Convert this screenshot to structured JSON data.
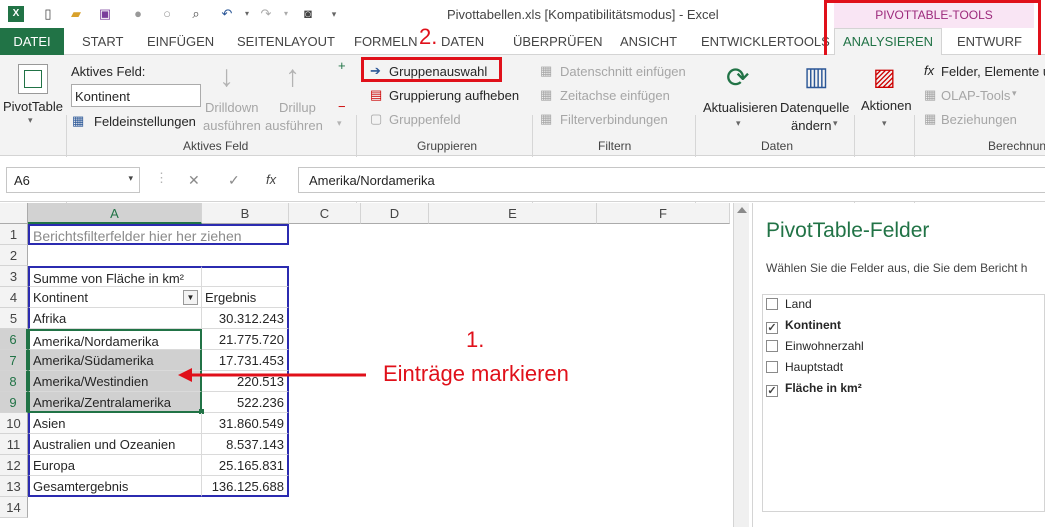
{
  "title": {
    "text": "Pivottabellen.xls  [Kompatibilitätsmodus] - Excel"
  },
  "qat": {
    "icons": [
      "excel-logo-icon",
      "new-file-icon",
      "open-folder-icon",
      "save-icon",
      "circle-icon",
      "print-preview-icon",
      "undo-icon",
      "redo-icon",
      "camera-icon",
      "qat-customize-icon"
    ]
  },
  "context": {
    "label": "PIVOTTABLE-TOOLS"
  },
  "tabs": {
    "file": "DATEI",
    "start": "START",
    "insert": "EINFÜGEN",
    "layout": "SEITENLAYOUT",
    "formulas": "FORMELN",
    "data": "DATEN",
    "review": "ÜBERPRÜFEN",
    "view": "ANSICHT",
    "dev": "ENTWICKLERTOOLS",
    "analyze": "ANALYSIEREN",
    "design": "ENTWURF"
  },
  "ribbon": {
    "pivottable": "PivotTable",
    "active_field_label": "Aktives Feld:",
    "active_field_value": "Kontinent",
    "field_settings": "Feldeinstellungen",
    "drilldown1": "Drilldown",
    "drilldown2": "ausführen",
    "drillup1": "Drillup",
    "drillup2": "ausführen",
    "group_active": "Aktives Feld",
    "group_selection": "Gruppenauswahl",
    "ungroup": "Gruppierung aufheben",
    "group_field": "Gruppenfeld",
    "group_gruppieren": "Gruppieren",
    "slicer": "Datenschnitt einfügen",
    "timeline": "Zeitachse einfügen",
    "filter_conn": "Filterverbindungen",
    "group_filter": "Filtern",
    "refresh": "Aktualisieren",
    "source1": "Datenquelle",
    "source2": "ändern",
    "group_data": "Daten",
    "actions": "Aktionen",
    "fields_items": "Felder, Elemente u",
    "olap": "OLAP-Tools",
    "relations": "Beziehungen",
    "group_calc": "Berechnun"
  },
  "annotations": {
    "step2": "2.",
    "step1": "1.",
    "mark_text": "Einträge markieren"
  },
  "formula_bar": {
    "name_box": "A6",
    "cancel": "✕",
    "confirm": "✓",
    "fx": "fx",
    "formula": "Amerika/Nordamerika"
  },
  "columns": [
    "A",
    "B",
    "C",
    "D",
    "E",
    "F"
  ],
  "rows": [
    "1",
    "2",
    "3",
    "4",
    "5",
    "6",
    "7",
    "8",
    "9",
    "10",
    "11",
    "12",
    "13",
    "14"
  ],
  "sheet": {
    "r1": "Berichtsfilterfelder hier her ziehen",
    "r3": "Summe von Fläche in km²",
    "r4a": "Kontinent",
    "r4b": "Ergebnis",
    "data": [
      {
        "a": "Afrika",
        "b": "30.312.243"
      },
      {
        "a": "Amerika/Nordamerika",
        "b": "21.775.720"
      },
      {
        "a": "Amerika/Südamerika",
        "b": "17.731.453"
      },
      {
        "a": "Amerika/Westindien",
        "b": "220.513"
      },
      {
        "a": "Amerika/Zentralamerika",
        "b": "522.236"
      },
      {
        "a": "Asien",
        "b": "31.860.549"
      },
      {
        "a": "Australien und Ozeanien",
        "b": "8.537.143"
      },
      {
        "a": "Europa",
        "b": "25.165.831"
      },
      {
        "a": "Gesamtergebnis",
        "b": "136.125.688"
      }
    ]
  },
  "panel": {
    "title": "PivotTable-Felder",
    "subtitle": "Wählen Sie die Felder aus, die Sie dem Bericht h",
    "fields": [
      {
        "label": "Land",
        "checked": false
      },
      {
        "label": "Kontinent",
        "checked": true
      },
      {
        "label": "Einwohnerzahl",
        "checked": false
      },
      {
        "label": "Hauptstadt",
        "checked": false
      },
      {
        "label": "Fläche in km²",
        "checked": true
      }
    ]
  },
  "colors": {
    "excel_green": "#217346",
    "annotation_red": "#e0101a",
    "context_pink": "#9c2a7c"
  }
}
